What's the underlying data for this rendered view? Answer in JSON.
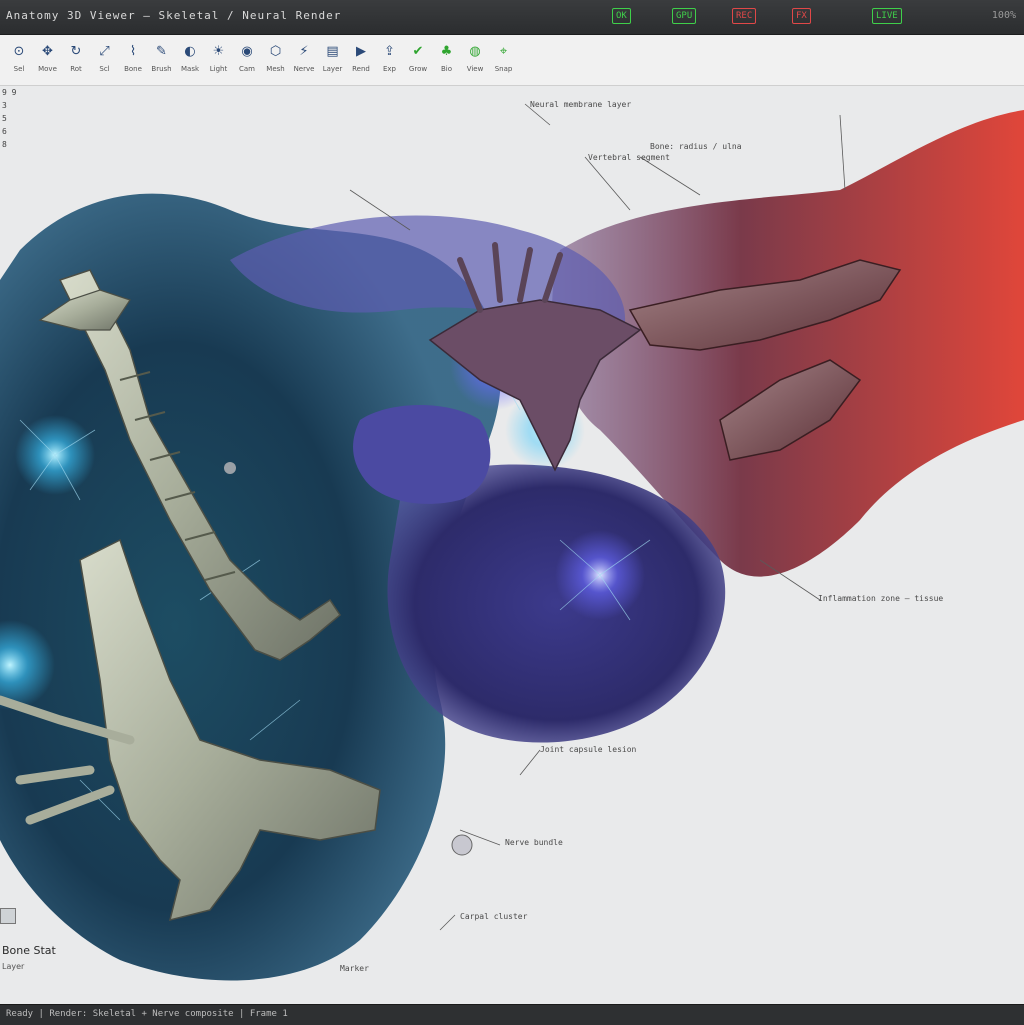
{
  "window": {
    "title": "Anatomy 3D Viewer — Skeletal / Neural Render",
    "right_info": "100%"
  },
  "status_chips": [
    {
      "label": "OK",
      "color": "#3fcf4a"
    },
    {
      "label": "GPU",
      "color": "#3fcf4a"
    },
    {
      "label": "REC",
      "color": "#e04848"
    },
    {
      "label": "FX",
      "color": "#e04848"
    },
    {
      "label": "LIVE",
      "color": "#3fcf4a"
    }
  ],
  "toolbar": {
    "tools": [
      {
        "name": "select-tool",
        "glyph": "⊙",
        "label": "Sel"
      },
      {
        "name": "move-tool",
        "glyph": "✥",
        "label": "Move"
      },
      {
        "name": "rotate-tool",
        "glyph": "↻",
        "label": "Rot"
      },
      {
        "name": "scale-tool",
        "glyph": "⤢",
        "label": "Scl"
      },
      {
        "name": "bone-tool",
        "glyph": "⌇",
        "label": "Bone"
      },
      {
        "name": "brush-tool",
        "glyph": "✎",
        "label": "Brush"
      },
      {
        "name": "mask-tool",
        "glyph": "◐",
        "label": "Mask"
      },
      {
        "name": "light-tool",
        "glyph": "☀",
        "label": "Light"
      },
      {
        "name": "camera-tool",
        "glyph": "◉",
        "label": "Cam"
      },
      {
        "name": "mesh-tool",
        "glyph": "⬡",
        "label": "Mesh"
      },
      {
        "name": "nerve-tool",
        "glyph": "⚡",
        "label": "Nerve"
      },
      {
        "name": "layer-tool",
        "glyph": "▤",
        "label": "Layer"
      },
      {
        "name": "render-tool",
        "glyph": "▶",
        "label": "Rend"
      },
      {
        "name": "export-tool",
        "glyph": "⇪",
        "label": "Exp"
      }
    ],
    "green_tools": [
      {
        "name": "grow-tool",
        "glyph": "✔",
        "label": "Grow"
      },
      {
        "name": "bio-tool",
        "glyph": "♣",
        "label": "Bio"
      },
      {
        "name": "view-tool",
        "glyph": "◍",
        "label": "View"
      },
      {
        "name": "snap-tool",
        "glyph": "⌖",
        "label": "Snap"
      }
    ]
  },
  "gutter": [
    "9 9",
    "3",
    "5",
    "6",
    "8"
  ],
  "annotations": [
    {
      "text": "Neural membrane layer"
    },
    {
      "text": "Bone: radius / ulna"
    },
    {
      "text": "Vertebral segment"
    },
    {
      "text": "Inflammation zone — tissue"
    },
    {
      "text": "Joint capsule lesion"
    },
    {
      "text": "Nerve bundle"
    },
    {
      "text": "Carpal cluster"
    },
    {
      "text": "Marker"
    }
  ],
  "bottom_left": {
    "label": "Bone Stat",
    "sub": "Layer"
  },
  "status": {
    "text": "Ready  |  Render: Skeletal + Nerve composite  |  Frame 1"
  }
}
